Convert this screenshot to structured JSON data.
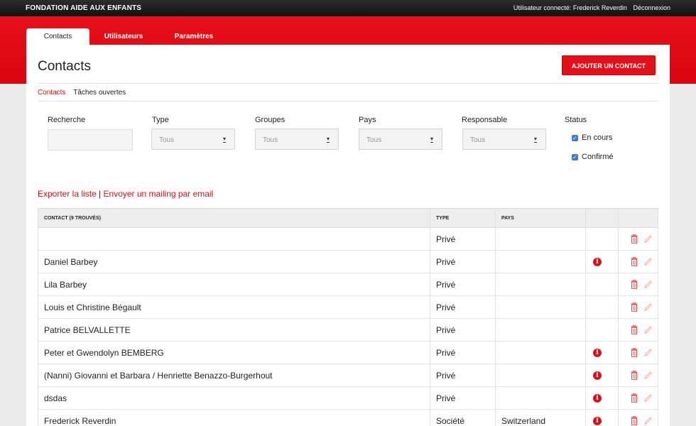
{
  "header": {
    "brand": "FONDATION AIDE AUX ENFANTS",
    "user_label": "Utilisateur connecté: Frederick Reverdin",
    "logout": "Déconnexion"
  },
  "tabs": [
    {
      "label": "Contacts",
      "active": true
    },
    {
      "label": "Utilisateurs",
      "active": false
    },
    {
      "label": "Paramètres",
      "active": false
    }
  ],
  "page": {
    "title": "Contacts",
    "add_button": "AJOUTER UN CONTACT",
    "subnav": [
      "Contacts",
      "Tâches ouvertes"
    ]
  },
  "filters": {
    "search_label": "Recherche",
    "search_value": "",
    "type_label": "Type",
    "type_value": "Tous",
    "groups_label": "Groupes",
    "groups_value": "Tous",
    "country_label": "Pays",
    "country_value": "Tous",
    "owner_label": "Responsable",
    "owner_value": "Tous",
    "status_label": "Status",
    "status_options": [
      {
        "label": "En cours",
        "checked": true
      },
      {
        "label": "Confirmé",
        "checked": true
      }
    ]
  },
  "actions": {
    "export": "Exporter la liste",
    "separator": "|",
    "mailing": "Envoyer un mailing par email"
  },
  "table": {
    "columns": [
      "CONTACT (9 TROUVÉS)",
      "TYPE",
      "PAYS"
    ],
    "rows": [
      {
        "name": "",
        "type": "Privé",
        "country": "",
        "info": false
      },
      {
        "name": "Daniel Barbey",
        "type": "Privé",
        "country": "",
        "info": true
      },
      {
        "name": "Lila Barbey",
        "type": "Privé",
        "country": "",
        "info": false
      },
      {
        "name": "Louis et Christine Bégault",
        "type": "Privé",
        "country": "",
        "info": false
      },
      {
        "name": "Patrice BELVALLETTE",
        "type": "Privé",
        "country": "",
        "info": false
      },
      {
        "name": "Peter et Gwendolyn BEMBERG",
        "type": "Privé",
        "country": "",
        "info": true
      },
      {
        "name": "(Nanni) Giovanni et Barbara / Henriette Benazzo-Burgerhout",
        "type": "Privé",
        "country": "",
        "info": true
      },
      {
        "name": "dsdas",
        "type": "Privé",
        "country": "",
        "info": true
      },
      {
        "name": "Frederick Reverdin",
        "type": "Société",
        "country": "Switzerland",
        "info": true
      }
    ]
  },
  "colors": {
    "accent": "#e3101a",
    "topbar": "#1a1a1a"
  },
  "icons": {
    "info": "info-icon",
    "delete": "trash-icon",
    "edit": "pencil-icon"
  }
}
